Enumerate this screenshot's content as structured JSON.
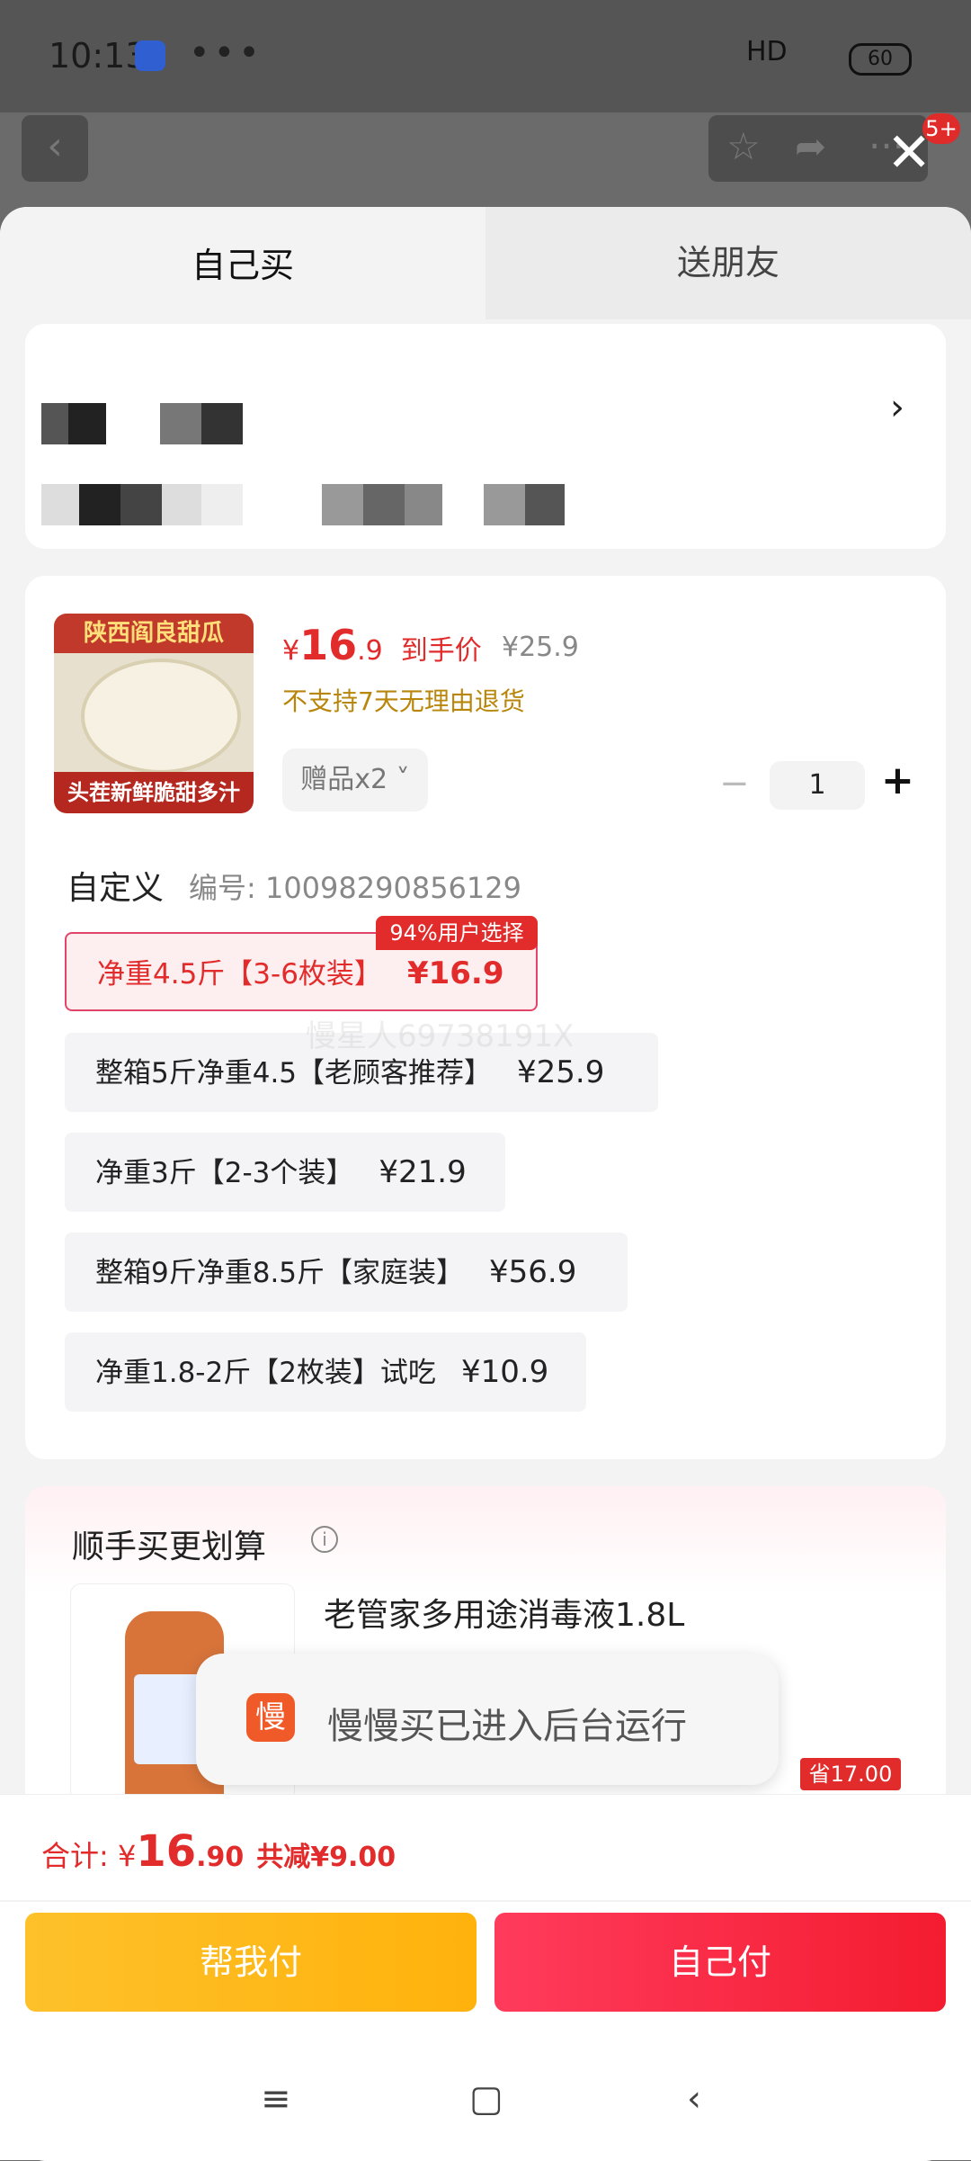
{
  "status_bar": {
    "time": "10:13",
    "dots": "•••",
    "signal": "HD",
    "battery": "60"
  },
  "tabs": {
    "self": "自己买",
    "friend": "送朋友"
  },
  "product": {
    "image_top_text": "陕西阎良甜瓜",
    "image_bottom_text": "头茬新鲜脆甜多汁",
    "price_currency": "¥",
    "price_int": "16",
    "price_dec": ".9",
    "price_label": "到手价",
    "orig_price": "¥25.9",
    "no_return": "不支持7天无理由退货",
    "gift": "赠品x2 ˅",
    "qty": "1",
    "minus": "−",
    "plus": "+"
  },
  "spec": {
    "title": "自定义",
    "number": "编号: 10098290856129",
    "popular_tag": "94%用户选择",
    "options": [
      {
        "label": "净重4.5斤【3-6枚装】",
        "price": "¥16.9"
      },
      {
        "label": "整箱5斤净重4.5【老顾客推荐】",
        "price": "¥25.9"
      },
      {
        "label": "净重3斤【2-3个装】",
        "price": "¥21.9"
      },
      {
        "label": "整箱9斤净重8.5斤【家庭装】",
        "price": "¥56.9"
      },
      {
        "label": "净重1.8-2斤【2枚装】试吃",
        "price": "¥10.9"
      }
    ],
    "watermark": "慢星人69738191X"
  },
  "addon": {
    "title": "顺手买更划算",
    "info_icon": "i",
    "item_name": "老管家多用途消毒液1.8L",
    "save_tag": "省17.00元"
  },
  "toast": {
    "logo_char": "慢",
    "message": "慢慢买已进入后台运行"
  },
  "summary": {
    "label": "合计: ¥",
    "int": "16",
    "dec": ".90",
    "reduce": "共减¥9.00"
  },
  "buttons": {
    "help_pay": "帮我付",
    "self_pay": "自己付"
  },
  "nav": {
    "menu": "≡",
    "home": "▢",
    "back": "‹"
  },
  "top_actions": {
    "back": "‹",
    "star": "☆",
    "share": "➦",
    "more": "···",
    "badge": "5+",
    "close": "✕"
  }
}
